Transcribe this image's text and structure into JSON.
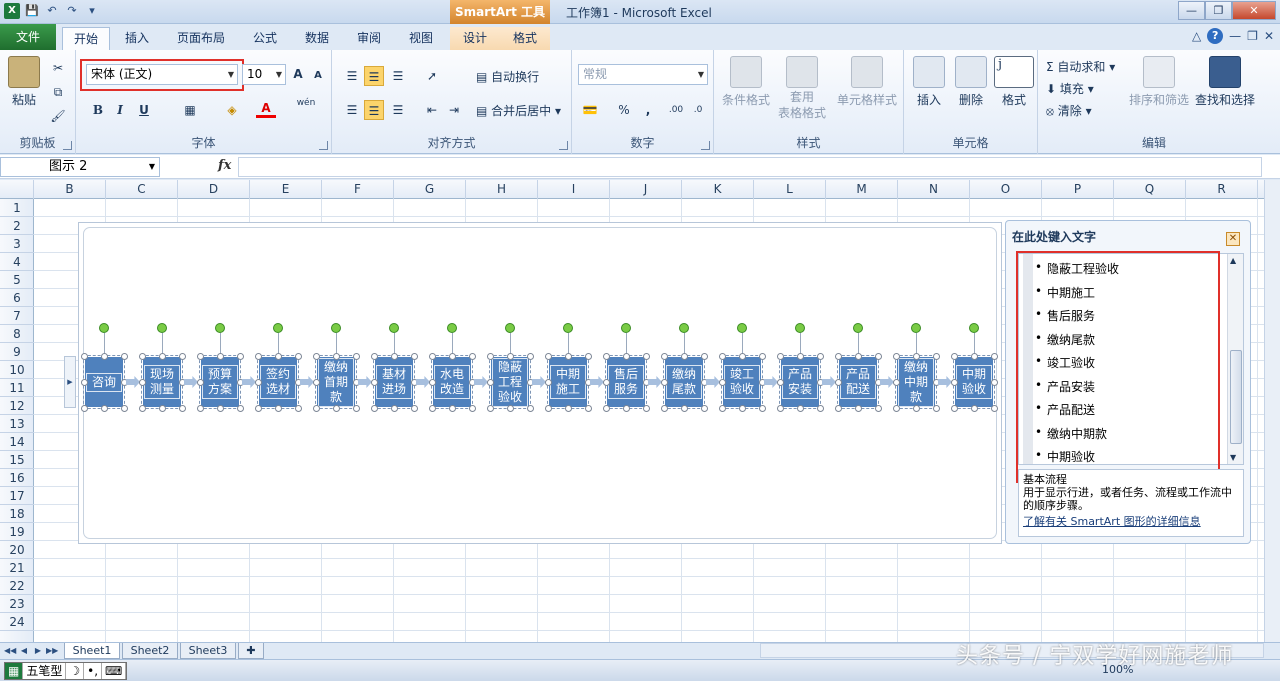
{
  "window": {
    "title": "工作簿1 - Microsoft Excel",
    "context_tab": "SmartArt 工具"
  },
  "tabs": [
    {
      "label": "文件"
    },
    {
      "label": "开始"
    },
    {
      "label": "插入"
    },
    {
      "label": "页面布局"
    },
    {
      "label": "公式"
    },
    {
      "label": "数据"
    },
    {
      "label": "审阅"
    },
    {
      "label": "视图"
    },
    {
      "label": "设计"
    },
    {
      "label": "格式"
    }
  ],
  "ribbon": {
    "clipboard": {
      "label": "剪贴板",
      "paste": "粘贴"
    },
    "font": {
      "label": "字体",
      "font_name": "宋体 (正文)",
      "font_size": "10",
      "bold": "B",
      "italic": "I",
      "underline": "U",
      "grow": "A",
      "shrink": "A",
      "wen": "wén"
    },
    "alignment": {
      "label": "对齐方式",
      "wrap": "自动换行",
      "merge": "合并后居中"
    },
    "number": {
      "label": "数字",
      "format": "常规",
      "percent": "%",
      "comma": ","
    },
    "styles": {
      "label": "样式",
      "conditional": "条件格式",
      "table_format_1": "套用",
      "table_format_2": "表格格式",
      "cell_styles": "单元格样式"
    },
    "cells": {
      "label": "单元格",
      "insert": "插入",
      "delete": "删除",
      "format": "格式"
    },
    "editing": {
      "label": "编辑",
      "autosum": "自动求和",
      "fill": "填充",
      "clear": "清除",
      "sort": "排序和筛选",
      "find": "查找和选择"
    }
  },
  "formula_bar": {
    "name_box": "图示 2",
    "fx": "fx",
    "value": ""
  },
  "columns": [
    "B",
    "C",
    "D",
    "E",
    "F",
    "G",
    "H",
    "I",
    "J",
    "K",
    "L",
    "M",
    "N",
    "O",
    "P",
    "Q",
    "R"
  ],
  "rows": [
    "1",
    "2",
    "3",
    "4",
    "5",
    "6",
    "7",
    "8",
    "9",
    "10",
    "11",
    "12",
    "13",
    "14",
    "15",
    "16",
    "17",
    "18",
    "19",
    "20",
    "21",
    "22",
    "23",
    "24"
  ],
  "smartart": {
    "shapes": [
      {
        "text": "咨询"
      },
      {
        "text": "现场测量"
      },
      {
        "text": "预算方案"
      },
      {
        "text": "签约选材"
      },
      {
        "text": "缴纳首期款"
      },
      {
        "text": "基材进场"
      },
      {
        "text": "水电改造"
      },
      {
        "text": "隐蔽工程验收"
      },
      {
        "text": "中期施工"
      },
      {
        "text": "售后服务"
      },
      {
        "text": "缴纳尾款"
      },
      {
        "text": "竣工验收"
      },
      {
        "text": "产品安装"
      },
      {
        "text": "产品配送"
      },
      {
        "text": "缴纳中期款"
      },
      {
        "text": "中期验收"
      }
    ]
  },
  "text_pane": {
    "title": "在此处键入文字",
    "items": [
      "隐蔽工程验收",
      "中期施工",
      "售后服务",
      "缴纳尾款",
      "竣工验收",
      "产品安装",
      "产品配送",
      "缴纳中期款",
      "中期验收"
    ],
    "layout_name": "基本流程",
    "layout_desc": "用于显示行进，或者任务、流程或工作流中的顺序步骤。",
    "link": "了解有关 SmartArt 图形的详细信息"
  },
  "sheets": [
    {
      "label": "Sheet1"
    },
    {
      "label": "Sheet2"
    },
    {
      "label": "Sheet3"
    }
  ],
  "status": {
    "ime": "五笔型",
    "zoom": "100%"
  },
  "watermark": "头条号 / 宁双学好网施老师",
  "colors": {
    "accent": "#4f81bd",
    "file_tab": "#2a8a3e",
    "context_tab": "#e59a44",
    "highlight": "#e0302a"
  }
}
